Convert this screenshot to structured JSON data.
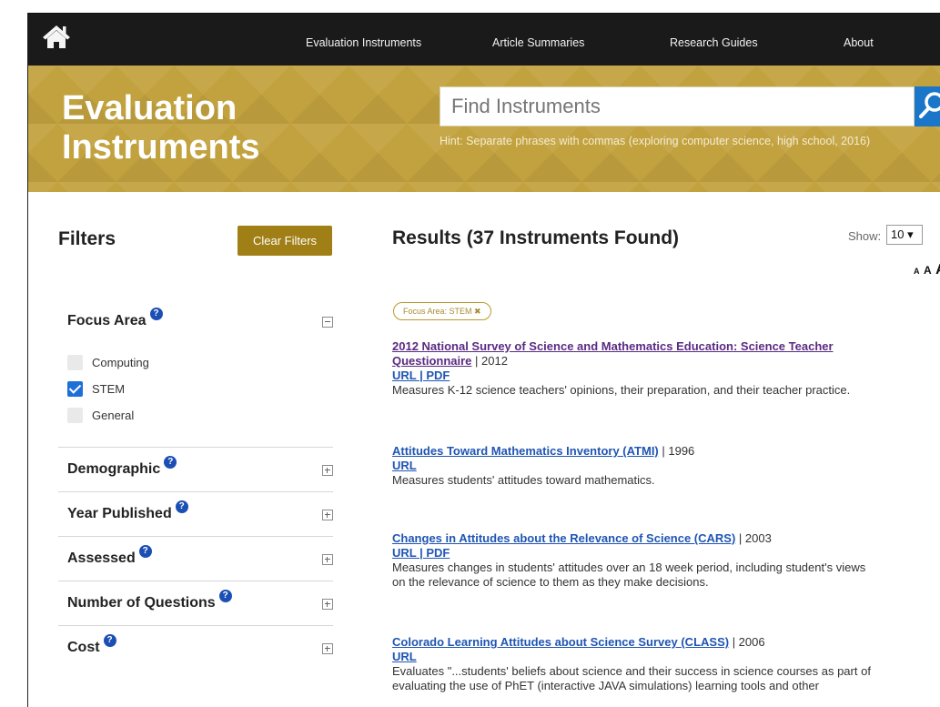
{
  "nav": {
    "links": [
      "Evaluation Instruments",
      "Article Summaries",
      "Research Guides",
      "About"
    ]
  },
  "hero": {
    "title": "Evaluation Instruments",
    "search_placeholder": "Find Instruments",
    "hint": "Hint: Separate phrases with commas (exploring computer science, high school, 2016)"
  },
  "sidebar": {
    "title": "Filters",
    "clear_label": "Clear Filters",
    "groups": [
      {
        "title": "Focus Area",
        "expanded": true,
        "options": [
          {
            "label": "Computing",
            "checked": false
          },
          {
            "label": "STEM",
            "checked": true
          },
          {
            "label": "General",
            "checked": false
          }
        ]
      },
      {
        "title": "Demographic",
        "expanded": false
      },
      {
        "title": "Year Published",
        "expanded": false
      },
      {
        "title": "Assessed",
        "expanded": false
      },
      {
        "title": "Number of Questions",
        "expanded": false
      },
      {
        "title": "Cost",
        "expanded": false
      }
    ]
  },
  "results": {
    "title": "Results (37 Instruments Found)",
    "show_label": "Show:",
    "show_value": "10 ▾",
    "font_sizes": [
      "A",
      "A",
      "A"
    ],
    "active_tag": "Focus Area: STEM ✖",
    "items": [
      {
        "title_line1": "2012 National Survey of Science and Mathematics Education: Science Teacher",
        "title_line2": "Questionnaire",
        "year": " | 2012",
        "links": "URL | PDF",
        "desc": "Measures K-12 science teachers' opinions, their preparation, and their teacher practice."
      },
      {
        "title_line1": "Attitudes Toward Mathematics Inventory (ATMI)",
        "year": " | 1996",
        "links": "URL",
        "desc": "Measures students' attitudes toward mathematics."
      },
      {
        "title_line1": "Changes in Attitudes about the Relevance of Science (CARS)",
        "year": " | 2003",
        "links": "URL | PDF",
        "desc_line1": "Measures changes in students' attitudes over an 18 week period, including student's views",
        "desc_line2": "on the relevance of science to them as they make decisions."
      },
      {
        "title_line1": "Colorado Learning Attitudes about Science Survey (CLASS)",
        "year": " | 2006",
        "links": "URL",
        "desc_line1": "Evaluates \"...students' beliefs about science and their success in science courses as part of",
        "desc_line2": "evaluating the use of PhET (interactive JAVA simulations) learning tools and other"
      }
    ]
  },
  "colors": {
    "navbar": "#1a1a1a",
    "hero_gold": "#c2a23f",
    "clear_button": "#a07f16",
    "search_button": "#1976c8",
    "link": "#1f55b3",
    "checkbox_checked": "#1e6fd8"
  },
  "icons": [
    "home-icon",
    "search-icon",
    "question-icon",
    "collapse-icon",
    "expand-icon",
    "checkbox-check-icon"
  ]
}
